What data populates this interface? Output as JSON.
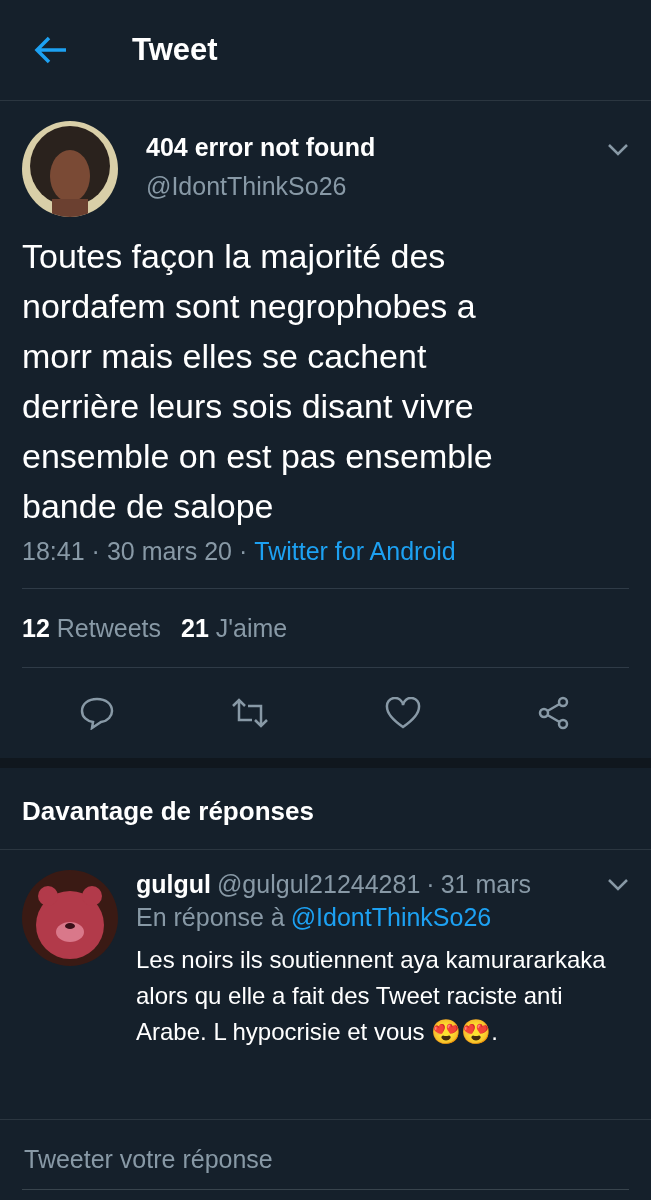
{
  "header": {
    "title": "Tweet"
  },
  "tweet": {
    "separator": "·",
    "display_name": "404 error not found",
    "handle": "@IdontThinkSo26",
    "text": "Toutes façon la majorité des nordafem sont negrophobes a morr mais elles se cachent derrière leurs sois disant vivre ensemble on est pas ensemble bande de salope",
    "time": "18:41",
    "date": "30 mars 20",
    "source": "Twitter for Android",
    "retweets": {
      "count": "12",
      "label": "Retweets"
    },
    "likes": {
      "count": "21",
      "label": "J'aime"
    }
  },
  "more_replies": {
    "title": "Davantage de réponses"
  },
  "reply": {
    "separator": "·",
    "display_name": "gulgul",
    "handle": "@gulgul21244281",
    "date": "31 mars",
    "in_reply_label": "En réponse à",
    "in_reply_handle": "@IdontThinkSo26",
    "text": "Les noirs ils soutiennent aya kamurararkaka alors qu elle a fait des Tweet raciste anti Arabe. L hypocrisie et vous 😍😍."
  },
  "compose": {
    "placeholder": "Tweeter votre réponse"
  }
}
